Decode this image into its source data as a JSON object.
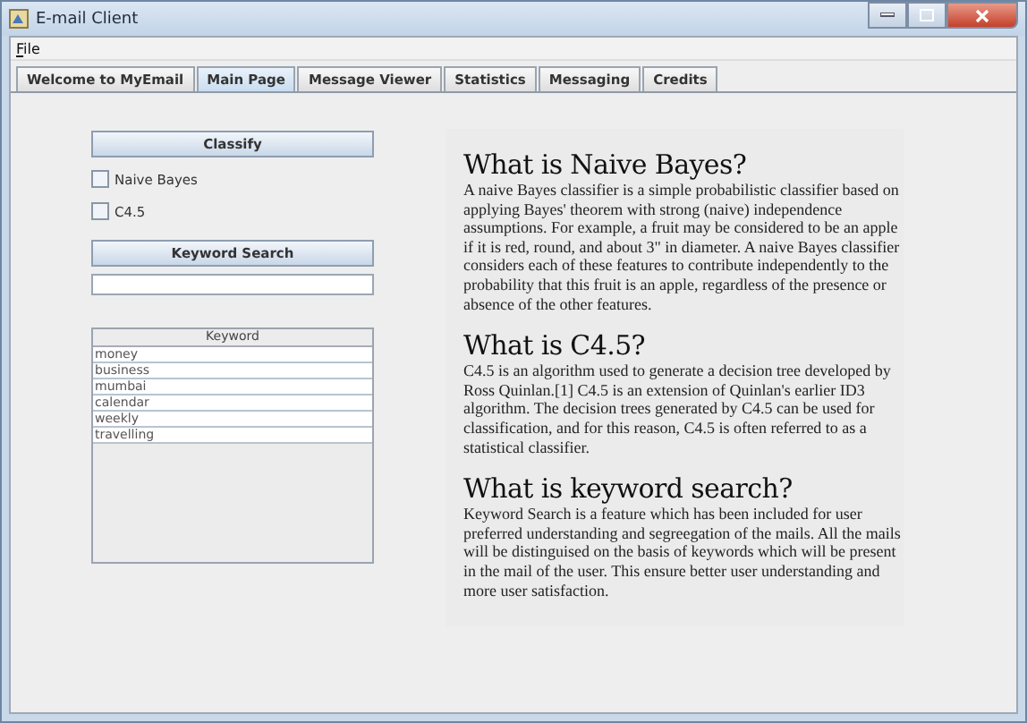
{
  "window": {
    "title": "E-mail Client"
  },
  "menu": [
    {
      "label": "File"
    }
  ],
  "tabs": [
    {
      "label": "Welcome to MyEmail",
      "selected": false
    },
    {
      "label": "Main Page",
      "selected": true
    },
    {
      "label": "Message Viewer",
      "selected": false
    },
    {
      "label": "Statistics",
      "selected": false
    },
    {
      "label": "Messaging",
      "selected": false
    },
    {
      "label": "Credits",
      "selected": false
    }
  ],
  "classify_button": "Classify",
  "options": [
    {
      "label": "Naive Bayes",
      "checked": false
    },
    {
      "label": "C4.5",
      "checked": false
    }
  ],
  "keyword_search_button": "Keyword Search",
  "table": {
    "columns": [
      "Keyword"
    ],
    "rows": [
      [
        "money"
      ],
      [
        "business"
      ],
      [
        "mumbai"
      ],
      [
        "calendar"
      ],
      [
        "weekly"
      ],
      [
        "travelling"
      ]
    ]
  },
  "sections": [
    {
      "heading": "What is Naive Bayes?",
      "text": "A naive Bayes classifier is a simple probabilistic classifier based on applying Bayes' theorem with strong (naive) independence assumptions. For example, a fruit may be considered to be an apple if it is red, round, and about 3\" in diameter. A naive Bayes classifier considers each of these features to contribute independently to the probability that this fruit is an apple, regardless of the presence or absence of the other features."
    },
    {
      "heading": "What is C4.5?",
      "text": "C4.5 is an algorithm used to generate a decision tree developed by Ross Quinlan.[1] C4.5 is an extension of Quinlan's earlier ID3 algorithm. The decision trees generated by C4.5 can be used for classification, and for this reason, C4.5 is often referred to as a statistical classifier."
    },
    {
      "heading": "What is keyword search?",
      "text": "Keyword Search is a feature which has been included for user preferred understanding and segreegation of the mails. All the mails will be distinguised on the basis of keywords which will be present in the mail of the user. This ensure better user understanding and more user satisfaction."
    }
  ]
}
